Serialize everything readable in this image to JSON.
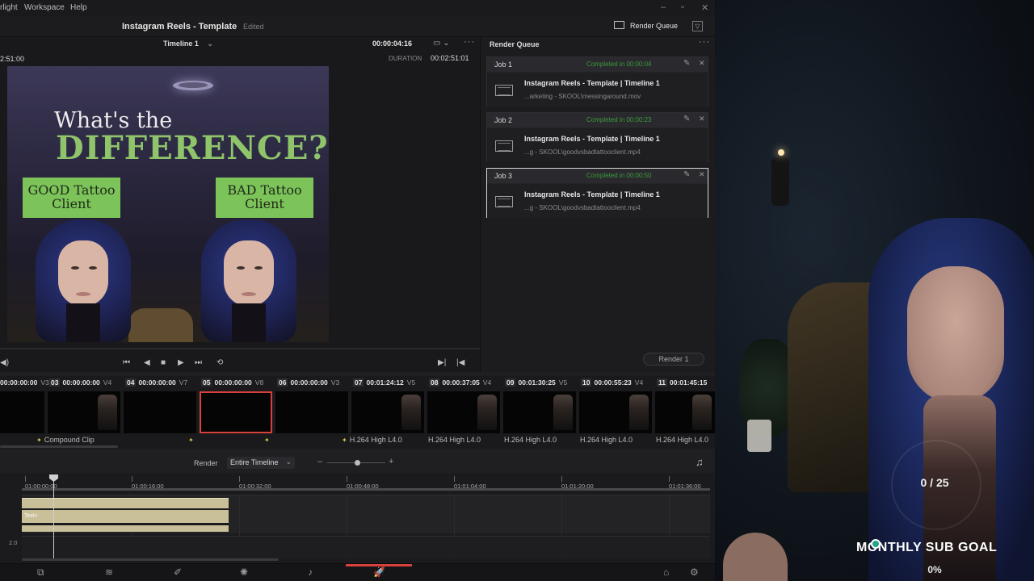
{
  "menu": {
    "app_fragment": "rlight",
    "workspace": "Workspace",
    "help": "Help"
  },
  "project": {
    "title": "Instagram Reels - Template",
    "status": "Edited"
  },
  "toolbar": {
    "render_queue_label": "Render Queue"
  },
  "viewer": {
    "timeline_name": "Timeline 1",
    "timecode": "00:00:04:16",
    "timecode_left": "2:51:00",
    "duration_label": "DURATION",
    "duration_value": "00:02:51:01",
    "overlay": {
      "line1": "What's the",
      "line2": "DIFFERENCE?",
      "left_box_line1": "GOOD Tattoo",
      "left_box_line2": "Client",
      "right_box_line1": "BAD Tattoo",
      "right_box_line2": "Client"
    }
  },
  "render_queue": {
    "title": "Render Queue",
    "render_button": "Render 1",
    "jobs": [
      {
        "name": "Job 1",
        "status": "Completed in 00:00:04",
        "timeline": "Instagram Reels - Template | Timeline 1",
        "path": "...arketing - SKOOL\\messingaround.mov"
      },
      {
        "name": "Job 2",
        "status": "Completed in 00:00:23",
        "timeline": "Instagram Reels - Template | Timeline 1",
        "path": "...g - SKOOL\\goodvsbadtattooclient.mp4"
      },
      {
        "name": "Job 3",
        "status": "Completed in 00:00:50",
        "timeline": "Instagram Reels - Template | Timeline 1",
        "path": "...g - SKOOL\\goodvsbadtattooclient.mp4"
      }
    ]
  },
  "clips": [
    {
      "num": "",
      "tc": "00:00:00:00",
      "track": "V3",
      "label": ""
    },
    {
      "num": "03",
      "tc": "00:00:00:00",
      "track": "V4",
      "label": "Compound Clip"
    },
    {
      "num": "04",
      "tc": "00:00:00:00",
      "track": "V7",
      "label": ""
    },
    {
      "num": "05",
      "tc": "00:00:00:00",
      "track": "V8",
      "label": ""
    },
    {
      "num": "06",
      "tc": "00:00:00:00",
      "track": "V3",
      "label": ""
    },
    {
      "num": "07",
      "tc": "00:01:24:12",
      "track": "V5",
      "label": "H.264 High L4.0"
    },
    {
      "num": "08",
      "tc": "00:00:37:05",
      "track": "V4",
      "label": "H.264 High L4.0"
    },
    {
      "num": "09",
      "tc": "00:01:30:25",
      "track": "V5",
      "label": "H.264 High L4.0"
    },
    {
      "num": "10",
      "tc": "00:00:55:23",
      "track": "V4",
      "label": "H.264 High L4.0"
    },
    {
      "num": "11",
      "tc": "00:01:45:15",
      "track": "",
      "label": "H.264 High L4.0"
    }
  ],
  "render_bar": {
    "label": "Render",
    "scope": "Entire Timeline"
  },
  "timeline": {
    "ruler": [
      "01:00:00:00",
      "01:00:16:00",
      "01:00:32:00",
      "01:00:48:00",
      "01:01:04:00",
      "01:01:20:00",
      "01:01:36:00"
    ],
    "text_clip_label": "Text+",
    "track_number": "2.0"
  },
  "sub_goal": {
    "count": "0 / 25",
    "title": "MONTHLY SUB GOAL",
    "percent": "0%",
    "progress": 0
  },
  "colors": {
    "accent_red": "#d6413c",
    "completed_green": "#3b9a3b",
    "overlay_green": "#7cc35a",
    "text_clip": "#c9c09a",
    "goal_teal": "#26a38a"
  }
}
